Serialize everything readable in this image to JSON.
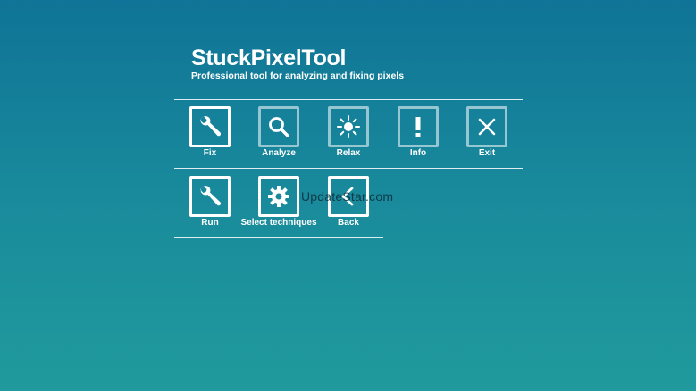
{
  "app": {
    "title": "StuckPixelTool",
    "subtitle": "Professional tool for analyzing and fixing pixels"
  },
  "main_menu": [
    {
      "label": "Fix",
      "icon": "wrench-icon",
      "state": "active"
    },
    {
      "label": "Analyze",
      "icon": "magnifier-icon",
      "state": "inactive"
    },
    {
      "label": "Relax",
      "icon": "sun-icon",
      "state": "inactive"
    },
    {
      "label": "Info",
      "icon": "exclamation-icon",
      "state": "inactive"
    },
    {
      "label": "Exit",
      "icon": "close-icon",
      "state": "inactive"
    }
  ],
  "sub_menu": [
    {
      "label": "Run",
      "icon": "wrench-icon",
      "state": "active"
    },
    {
      "label": "Select techniques",
      "icon": "gear-icon",
      "state": "active"
    },
    {
      "label": "Back",
      "icon": "back-arrow-icon",
      "state": "active"
    }
  ],
  "watermark": "UpdateStar.com",
  "colors": {
    "background_top": "#0f7497",
    "background_bottom": "#209a9c",
    "foreground": "#ffffff"
  }
}
